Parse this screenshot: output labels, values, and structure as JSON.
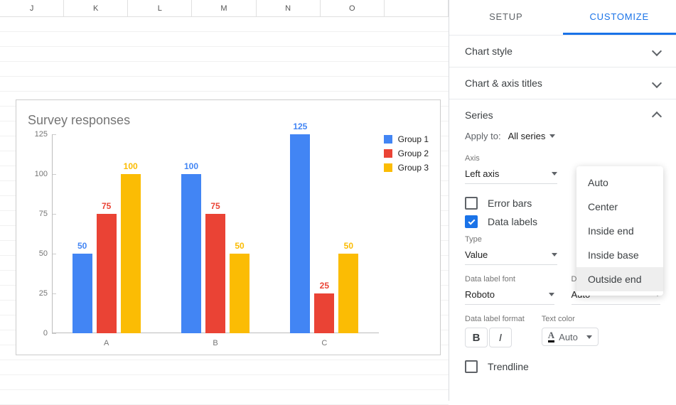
{
  "spreadsheet": {
    "columns": [
      "J",
      "K",
      "L",
      "M",
      "N",
      "O",
      ""
    ]
  },
  "chart_data": {
    "type": "bar",
    "title": "Survey responses",
    "categories": [
      "A",
      "B",
      "C"
    ],
    "series": [
      {
        "name": "Group 1",
        "values": [
          50,
          100,
          125
        ],
        "color": "#4285f4"
      },
      {
        "name": "Group 2",
        "values": [
          75,
          75,
          25
        ],
        "color": "#ea4335"
      },
      {
        "name": "Group 3",
        "values": [
          100,
          50,
          50
        ],
        "color": "#fbbc04"
      }
    ],
    "xlabel": "",
    "ylabel": "",
    "ylim": [
      0,
      125
    ],
    "yticks": [
      0,
      25,
      50,
      75,
      100,
      125
    ],
    "legend_position": "right",
    "data_labels": true
  },
  "panel": {
    "tabs": {
      "setup": "SETUP",
      "customize": "CUSTOMIZE"
    },
    "sections": {
      "chart_style": "Chart style",
      "chart_axis_titles": "Chart & axis titles",
      "series": "Series"
    },
    "series": {
      "apply_to_label": "Apply to:",
      "apply_to_value": "All series",
      "axis_label": "Axis",
      "axis_value": "Left axis",
      "error_bars": "Error bars",
      "data_labels": "Data labels",
      "type_label": "Type",
      "type_value": "Value",
      "font_label": "Data label font",
      "font_value": "Roboto",
      "font_size_label": "Data label font size",
      "font_size_value": "Auto",
      "format_label": "Data label format",
      "text_color_label": "Text color",
      "text_color_value": "Auto",
      "trendline": "Trendline"
    },
    "position_dropdown": {
      "options": [
        "Auto",
        "Center",
        "Inside end",
        "Inside base",
        "Outside end"
      ],
      "hover": "Outside end"
    }
  }
}
